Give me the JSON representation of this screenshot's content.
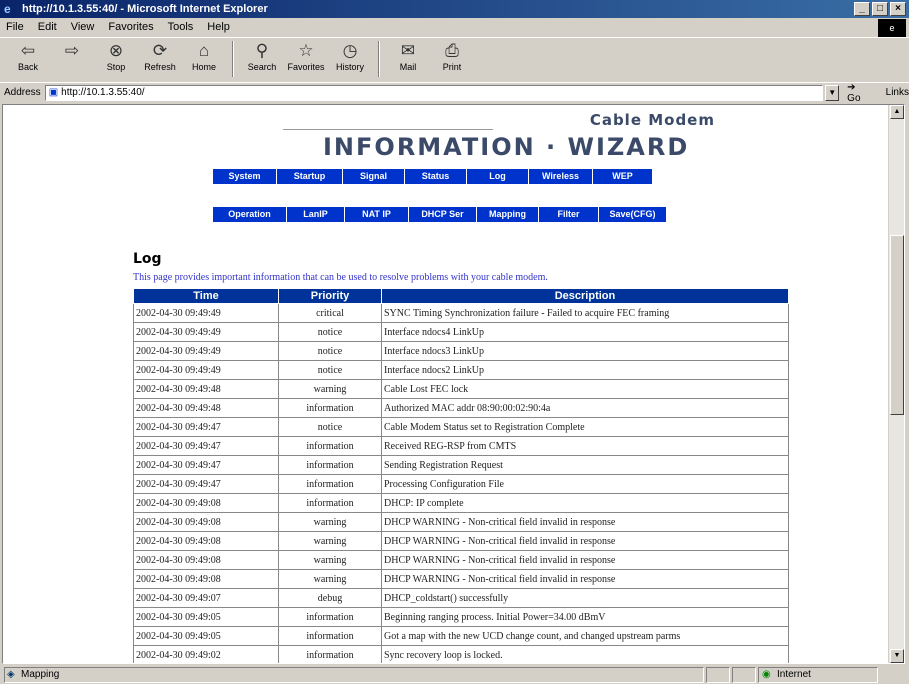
{
  "window": {
    "title": "http://10.1.3.55:40/ - Microsoft Internet Explorer",
    "controls": [
      "_",
      "□",
      "×"
    ]
  },
  "menubar": [
    "File",
    "Edit",
    "View",
    "Favorites",
    "Tools",
    "Help"
  ],
  "toolbar": {
    "back": "Back",
    "forward": "",
    "stop": "Stop",
    "refresh": "Refresh",
    "home": "Home",
    "search": "Search",
    "favorites": "Favorites",
    "history": "History",
    "mail": "Mail",
    "print": "Print"
  },
  "address": {
    "label": "Address",
    "value": "http://10.1.3.55:40/",
    "go": "Go",
    "links": "Links"
  },
  "brand": {
    "sub": "Cable Modem",
    "main": "INFORMATION · WIZARD"
  },
  "nav_row1": [
    "System",
    "Startup",
    "Signal",
    "Status",
    "Log",
    "Wireless",
    "WEP"
  ],
  "nav_row2": [
    "Operation",
    "LanIP",
    "NAT IP",
    "DHCP Ser",
    "Mapping",
    "Filter",
    "Save(CFG)"
  ],
  "log": {
    "heading": "Log",
    "intro": "This page provides important information that can be used to resolve problems with your cable modem.",
    "columns": [
      "Time",
      "Priority",
      "Description"
    ],
    "rows": [
      [
        "2002-04-30 09:49:49",
        "critical",
        "SYNC Timing Synchronization failure - Failed to acquire FEC framing"
      ],
      [
        "2002-04-30 09:49:49",
        "notice",
        "Interface ndocs4 LinkUp"
      ],
      [
        "2002-04-30 09:49:49",
        "notice",
        "Interface ndocs3 LinkUp"
      ],
      [
        "2002-04-30 09:49:49",
        "notice",
        "Interface ndocs2 LinkUp"
      ],
      [
        "2002-04-30 09:49:48",
        "warning",
        "Cable Lost FEC lock"
      ],
      [
        "2002-04-30 09:49:48",
        "information",
        "Authorized MAC addr 08:90:00:02:90:4a"
      ],
      [
        "2002-04-30 09:49:47",
        "notice",
        "Cable Modem Status set to Registration Complete"
      ],
      [
        "2002-04-30 09:49:47",
        "information",
        "Received REG-RSP from CMTS"
      ],
      [
        "2002-04-30 09:49:47",
        "information",
        "Sending Registration Request"
      ],
      [
        "2002-04-30 09:49:47",
        "information",
        "Processing Configuration File"
      ],
      [
        "2002-04-30 09:49:08",
        "information",
        "DHCP: IP complete"
      ],
      [
        "2002-04-30 09:49:08",
        "warning",
        "DHCP WARNING - Non-critical field invalid in response"
      ],
      [
        "2002-04-30 09:49:08",
        "warning",
        "DHCP WARNING - Non-critical field invalid in response"
      ],
      [
        "2002-04-30 09:49:08",
        "warning",
        "DHCP WARNING - Non-critical field invalid in response"
      ],
      [
        "2002-04-30 09:49:08",
        "warning",
        "DHCP WARNING - Non-critical field invalid in response"
      ],
      [
        "2002-04-30 09:49:07",
        "debug",
        "DHCP_coldstart() successfully"
      ],
      [
        "2002-04-30 09:49:05",
        "information",
        "Beginning ranging process. Initial Power=34.00 dBmV"
      ],
      [
        "2002-04-30 09:49:05",
        "information",
        "Got a map with the new UCD change count, and changed upstream parms"
      ],
      [
        "2002-04-30 09:49:02",
        "information",
        "Sync recovery loop is locked."
      ]
    ]
  },
  "status": {
    "text": "Mapping",
    "zone": "Internet"
  }
}
